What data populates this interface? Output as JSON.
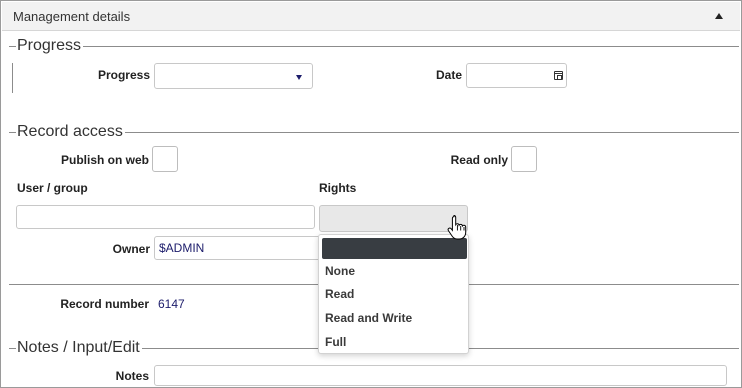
{
  "panel": {
    "title": "Management details"
  },
  "progress_section": {
    "title": "Progress",
    "progress_label": "Progress",
    "progress_value": "",
    "date_label": "Date",
    "date_value": ""
  },
  "record_access": {
    "title": "Record access",
    "publish_on_web_label": "Publish on web",
    "read_only_label": "Read only",
    "user_group_label": "User / group",
    "user_group_value": "",
    "rights_label": "Rights",
    "rights_value": "",
    "owner_label": "Owner",
    "owner_value": "$ADMIN",
    "record_number_label": "Record number",
    "record_number_value": "6147"
  },
  "rights_dropdown": {
    "options": [
      "",
      "None",
      "Read",
      "Read and Write",
      "Full"
    ],
    "highlighted_index": 0
  },
  "notes_section": {
    "title": "Notes / Input/Edit",
    "notes_label": "Notes",
    "notes_value": ""
  },
  "colors": {
    "value_text": "#1c1c6b",
    "dropdown_highlight": "#383d42",
    "header_bg": "#f2f2f2"
  },
  "icons": {
    "collapse": "triangle-up-icon",
    "select_caret": "chevron-down-icon",
    "calendar": "calendar-icon",
    "cursor": "hand-pointer-icon"
  }
}
